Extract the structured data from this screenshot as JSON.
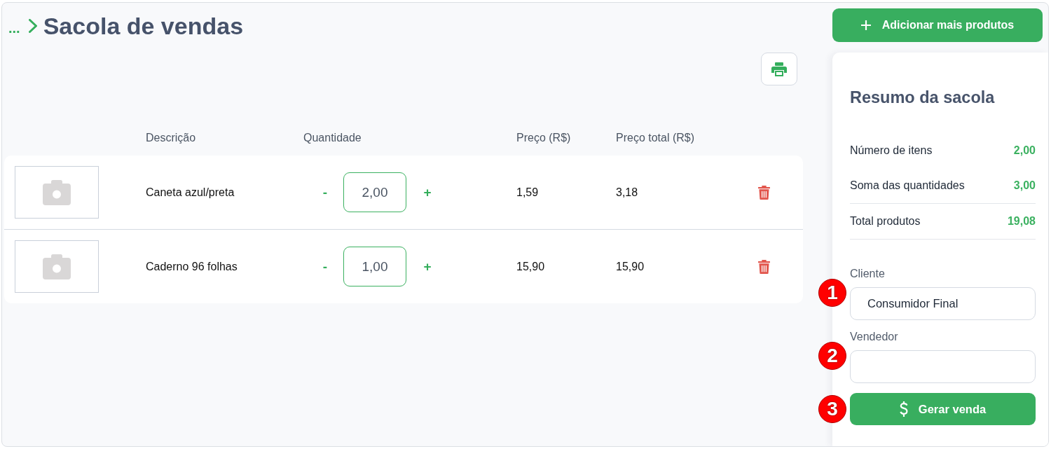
{
  "breadcrumb": {
    "ellipsis": "...",
    "title": "Sacola de vendas"
  },
  "add_products_button": {
    "label": "Adicionar mais produtos"
  },
  "table": {
    "columns": [
      "Descrição",
      "Quantidade",
      "Preço (R$)",
      "Preço total (R$)"
    ],
    "rows": [
      {
        "description": "Caneta azul/preta",
        "decrement": "-",
        "quantity": "2,00",
        "increment": "+",
        "price": "1,59",
        "total": "3,18"
      },
      {
        "description": "Caderno 96 folhas",
        "decrement": "-",
        "quantity": "1,00",
        "increment": "+",
        "price": "15,90",
        "total": "15,90"
      }
    ]
  },
  "summary": {
    "title": "Resumo da sacola",
    "lines": [
      {
        "label": "Número de itens",
        "value": "2,00",
        "divider": false
      },
      {
        "label": "Soma das quantidades",
        "value": "3,00",
        "divider": true
      },
      {
        "label": "Total produtos",
        "value": "19,08",
        "divider": true
      }
    ],
    "fields": [
      {
        "label": "Cliente",
        "value": "Consumidor Final",
        "callout": "1"
      },
      {
        "label": "Vendedor",
        "callout": "2"
      }
    ],
    "submit": {
      "label": "Gerar venda",
      "callout": "3"
    }
  }
}
